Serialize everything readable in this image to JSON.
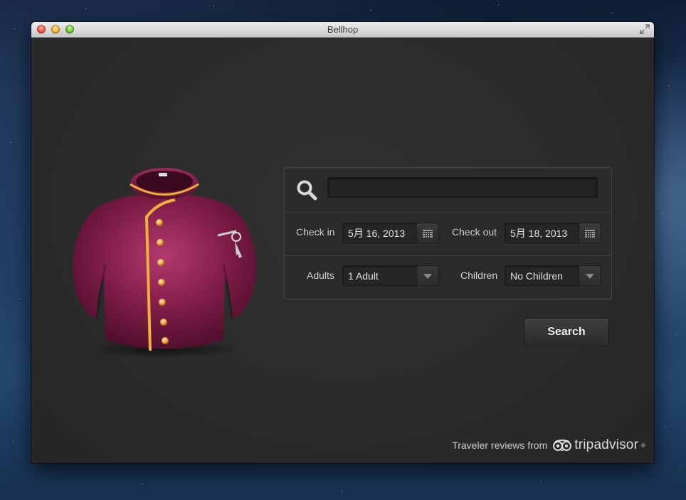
{
  "window": {
    "title": "Bellhop"
  },
  "search": {
    "value": "",
    "placeholder": ""
  },
  "dates": {
    "check_in_label": "Check in",
    "check_in_value": "5月 16, 2013",
    "check_out_label": "Check out",
    "check_out_value": "5月 18, 2013"
  },
  "guests": {
    "adults_label": "Adults",
    "adults_value": "1 Adult",
    "children_label": "Children",
    "children_value": "No Children"
  },
  "actions": {
    "search_label": "Search"
  },
  "footer": {
    "credits_text": "Traveler reviews from",
    "brand": "tripadvisor",
    "brand_mark": "®"
  },
  "icons": {
    "search": "search-icon",
    "calendar": "calendar-icon",
    "dropdown": "chevron-down-icon",
    "app": "bellhop-jacket-icon",
    "brand_logo": "tripadvisor-owl-icon"
  },
  "colors": {
    "jacket": "#8a1f4a",
    "piping": "#f0b13a",
    "window_bg": "#2a2a2a"
  }
}
